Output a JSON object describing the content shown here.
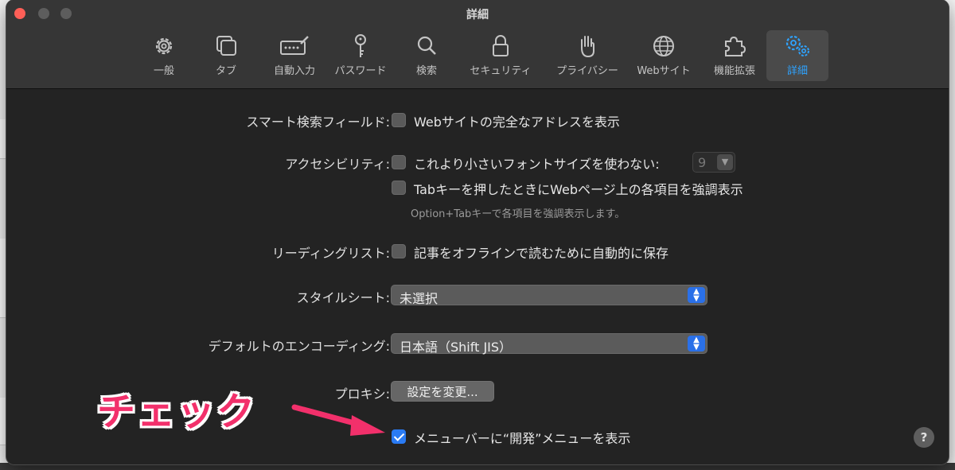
{
  "window": {
    "title": "詳細",
    "accent_color": "#2a7bf4",
    "annotation_color": "#f2306b"
  },
  "toolbar": {
    "items": [
      {
        "label": "一般",
        "icon": "gear-icon"
      },
      {
        "label": "タブ",
        "icon": "tabs-icon"
      },
      {
        "label": "自動入力",
        "icon": "autofill-icon"
      },
      {
        "label": "パスワード",
        "icon": "key-icon"
      },
      {
        "label": "検索",
        "icon": "search-icon"
      },
      {
        "label": "セキュリティ",
        "icon": "lock-icon"
      },
      {
        "label": "プライバシー",
        "icon": "hand-icon"
      },
      {
        "label": "Webサイト",
        "icon": "globe-icon"
      },
      {
        "label": "機能拡張",
        "icon": "puzzle-icon"
      },
      {
        "label": "詳細",
        "icon": "gears-icon",
        "active": true
      }
    ]
  },
  "settings": {
    "smart_search": {
      "label": "スマート検索フィールド:",
      "option": "Webサイトの完全なアドレスを表示",
      "checked": false
    },
    "accessibility": {
      "label": "アクセシビリティ:",
      "option_font": "これより小さいフォントサイズを使わない:",
      "font_size": "9",
      "option_tab": "Tabキーを押したときにWebページ上の各項目を強調表示",
      "hint": "Option+Tabキーで各項目を強調表示します。"
    },
    "reading_list": {
      "label": "リーディングリスト:",
      "option": "記事をオフラインで読むために自動的に保存"
    },
    "stylesheet": {
      "label": "スタイルシート:",
      "value": "未選択"
    },
    "encoding": {
      "label": "デフォルトのエンコーディング:",
      "value": "日本語（Shift JIS）"
    },
    "proxy": {
      "label": "プロキシ:",
      "button": "設定を変更..."
    },
    "develop_menu": {
      "option": "メニューバーに“開発”メニューを表示",
      "checked": true
    }
  },
  "help": {
    "label": "?"
  },
  "annotation": {
    "text": "チェック"
  }
}
